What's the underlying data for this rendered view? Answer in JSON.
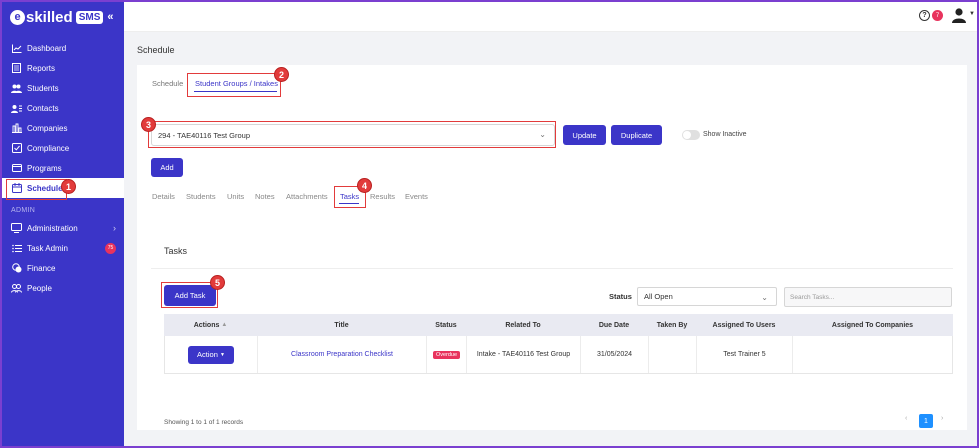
{
  "brand": {
    "e": "e",
    "name": "skilled",
    "sms": "SMS",
    "collapse": "«"
  },
  "sidebar": {
    "items": [
      {
        "label": "Dashboard",
        "icon": "chart-line-icon"
      },
      {
        "label": "Reports",
        "icon": "report-icon"
      },
      {
        "label": "Students",
        "icon": "users-icon"
      },
      {
        "label": "Contacts",
        "icon": "contact-card-icon"
      },
      {
        "label": "Companies",
        "icon": "building-icon"
      },
      {
        "label": "Compliance",
        "icon": "compliance-icon"
      },
      {
        "label": "Programs",
        "icon": "programs-icon"
      },
      {
        "label": "Schedule",
        "icon": "calendar-icon"
      }
    ],
    "admin_section": "ADMIN",
    "admin_items": [
      {
        "label": "Administration",
        "icon": "monitor-icon"
      },
      {
        "label": "Task Admin",
        "icon": "list-icon",
        "badge": "75"
      },
      {
        "label": "Finance",
        "icon": "coins-icon"
      },
      {
        "label": "People",
        "icon": "people-icon"
      }
    ]
  },
  "topbar": {
    "help": "?",
    "notifications": "7"
  },
  "page_title": "Schedule",
  "tabs": [
    "Schedule",
    "Student Groups / Intakes"
  ],
  "group": {
    "selected": "294 - TAE40116 Test Group",
    "update": "Update",
    "duplicate": "Duplicate",
    "show_inactive": "Show Inactive",
    "add": "Add"
  },
  "subtabs": [
    "Details",
    "Students",
    "Units",
    "Notes",
    "Attachments",
    "Tasks",
    "Results",
    "Events"
  ],
  "tasks": {
    "title": "Tasks",
    "add_task": "Add Task",
    "status_label": "Status",
    "status_value": "All Open",
    "search_placeholder": "Search Tasks...",
    "columns": [
      "Actions",
      "Title",
      "Status",
      "Related To",
      "Due Date",
      "Taken By",
      "Assigned To Users",
      "Assigned To Companies"
    ],
    "rows": [
      {
        "action": "Action",
        "title": "Classroom Preparation Checklist",
        "status": "Overdue",
        "related": "Intake - TAE40116 Test Group",
        "due": "31/05/2024",
        "taken_by": "",
        "users": "Test Trainer 5",
        "companies": ""
      }
    ],
    "showing": "Showing 1 to 1 of 1 records",
    "page": "1"
  },
  "callouts": [
    "1",
    "2",
    "3",
    "4",
    "5"
  ],
  "colors": {
    "brand": "#3b35c8",
    "highlight": "#e23b3b",
    "badge": "#e8335d"
  }
}
